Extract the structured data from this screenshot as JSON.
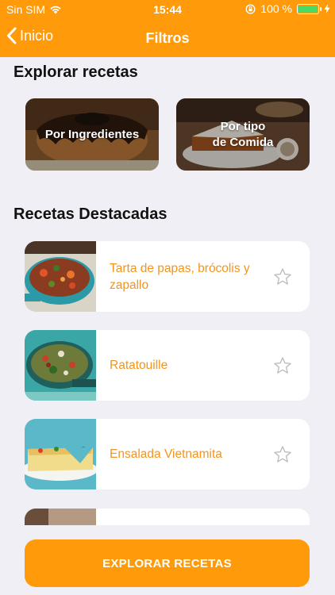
{
  "status_bar": {
    "carrier": "Sin SIM",
    "time": "15:44",
    "battery": "100 %",
    "battery_level": 1.0,
    "icons": [
      "wifi-icon",
      "orientation-lock-icon",
      "battery-icon",
      "charging-bolt-icon"
    ]
  },
  "nav": {
    "back_label": "Inicio",
    "title": "Filtros",
    "back_icon": "chevron-left-icon"
  },
  "explore": {
    "title": "Explorar recetas",
    "cards": [
      {
        "label": "Por Ingredientes"
      },
      {
        "label": "Por tipo\nde Comida"
      }
    ]
  },
  "featured": {
    "title": "Recetas Destacadas",
    "items": [
      {
        "name": "Tarta de papas, brócolis y zapallo",
        "starred": false
      },
      {
        "name": "Ratatouille",
        "starred": false
      },
      {
        "name": "Ensalada Vietnamita",
        "starred": false
      },
      {
        "name": "",
        "starred": false
      }
    ]
  },
  "cta": {
    "label": "EXPLORAR RECETAS"
  },
  "colors": {
    "accent": "#ff9a0a",
    "recipe_text": "#f2941f",
    "background": "#f0eff5"
  }
}
